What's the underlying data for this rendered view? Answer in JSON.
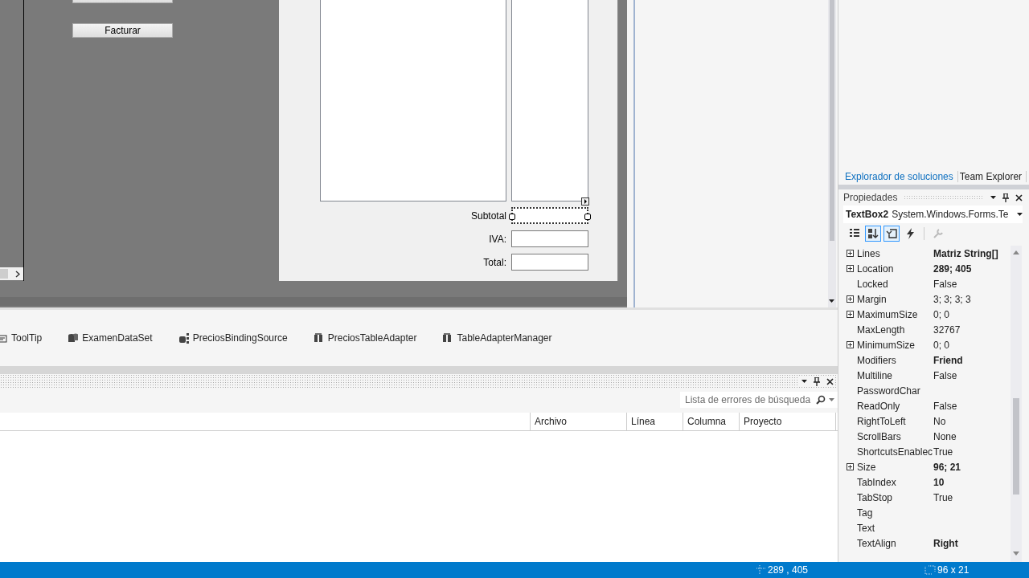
{
  "designer": {
    "button": "Facturar",
    "fields": [
      {
        "label": "Subtotal",
        "selected": true
      },
      {
        "label": "IVA:",
        "selected": false
      },
      {
        "label": "Total:",
        "selected": false
      }
    ]
  },
  "tray": {
    "components": [
      {
        "name": "ToolTip",
        "kind": "tooltip"
      },
      {
        "name": "ExamenDataSet",
        "kind": "dataset"
      },
      {
        "name": "PreciosBindingSource",
        "kind": "binding"
      },
      {
        "name": "PreciosTableAdapter",
        "kind": "adapter"
      },
      {
        "name": "TableAdapterManager",
        "kind": "adapter"
      }
    ]
  },
  "error_list": {
    "search": {
      "placeholder": "Lista de errores de búsqueda"
    },
    "columns": [
      "Archivo",
      "Línea",
      "Columna",
      "Proyecto"
    ]
  },
  "explorer_tabs": [
    {
      "label": "Explorador de soluciones",
      "selected": true
    },
    {
      "label": "Team Explorer",
      "selected": false
    }
  ],
  "properties": {
    "title": "Propiedades",
    "object_name": "TextBox2",
    "object_type": "System.Windows.Forms.Te",
    "toolbar": [
      {
        "kind": "categorized",
        "selected": false,
        "disabled": false
      },
      {
        "kind": "alphabetical",
        "selected": true,
        "disabled": false
      },
      {
        "kind": "properties",
        "selected": true,
        "disabled": false
      },
      {
        "kind": "events",
        "selected": false,
        "disabled": false
      },
      {
        "kind": "pages",
        "selected": false,
        "disabled": true
      }
    ],
    "rows": [
      {
        "name": "Lines",
        "expandable": true,
        "value": "Matriz String[]",
        "modified": true
      },
      {
        "name": "Location",
        "expandable": true,
        "value": "289; 405",
        "modified": true
      },
      {
        "name": "Locked",
        "expandable": false,
        "value": "False",
        "modified": false
      },
      {
        "name": "Margin",
        "expandable": true,
        "value": "3; 3; 3; 3",
        "modified": false
      },
      {
        "name": "MaximumSize",
        "expandable": true,
        "value": "0; 0",
        "modified": false
      },
      {
        "name": "MaxLength",
        "expandable": false,
        "value": "32767",
        "modified": false
      },
      {
        "name": "MinimumSize",
        "expandable": true,
        "value": "0; 0",
        "modified": false
      },
      {
        "name": "Modifiers",
        "expandable": false,
        "value": "Friend",
        "modified": true
      },
      {
        "name": "Multiline",
        "expandable": false,
        "value": "False",
        "modified": false
      },
      {
        "name": "PasswordChar",
        "expandable": false
      },
      {
        "name": "ReadOnly",
        "expandable": false,
        "value": "False",
        "modified": false
      },
      {
        "name": "RightToLeft",
        "expandable": false,
        "value": "No",
        "modified": false
      },
      {
        "name": "ScrollBars",
        "expandable": false,
        "value": "None",
        "modified": false
      },
      {
        "name": "ShortcutsEnablec",
        "expandable": false,
        "value": "True",
        "modified": false
      },
      {
        "name": "Size",
        "expandable": true,
        "value": "96; 21",
        "modified": true
      },
      {
        "name": "TabIndex",
        "expandable": false,
        "value": "10",
        "modified": true
      },
      {
        "name": "TabStop",
        "expandable": false,
        "value": "True",
        "modified": false
      },
      {
        "name": "Tag",
        "expandable": false
      },
      {
        "name": "Text",
        "expandable": false
      },
      {
        "name": "TextAlign",
        "expandable": false,
        "value": "Right",
        "modified": true
      }
    ]
  },
  "status_bar": {
    "location": "289 , 405",
    "size": "96 x 21"
  }
}
